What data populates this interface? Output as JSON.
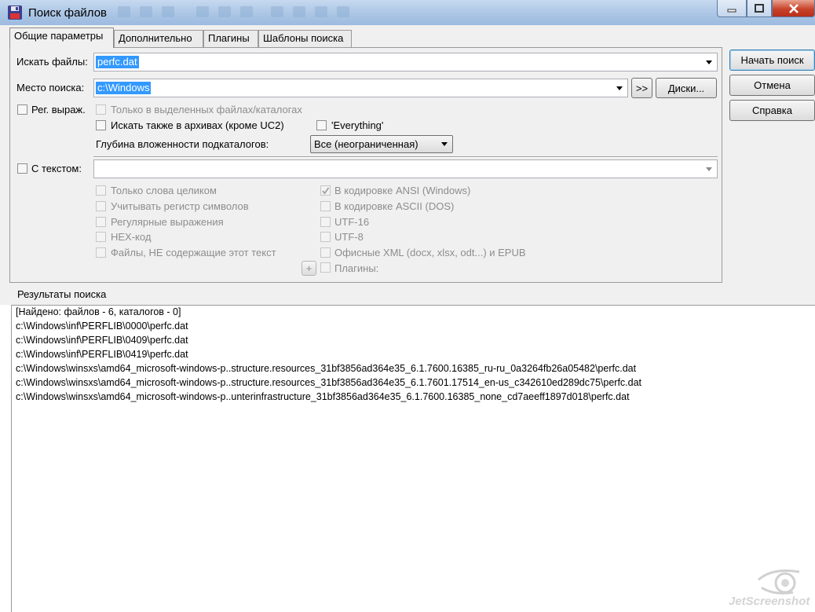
{
  "window": {
    "title": "Поиск файлов"
  },
  "tabs": [
    {
      "label": "Общие параметры"
    },
    {
      "label": "Дополнительно"
    },
    {
      "label": "Плагины"
    },
    {
      "label": "Шаблоны поиска"
    }
  ],
  "search": {
    "files_label": "Искать файлы:",
    "files_value": "perfc.dat",
    "location_label": "Место поиска:",
    "location_value": "c:\\Windows",
    "browse_label": ">>",
    "drives_label": "Диски...",
    "regex_label": "Рег. выраж.",
    "selected_only_label": "Только в выделенных файлах/каталогах",
    "archives_label": "Искать также в архивах (кроме UC2)",
    "everything_label": "'Everything'",
    "depth_label": "Глубина вложенности подкаталогов:",
    "depth_value": "Все (неограниченная)"
  },
  "text_search": {
    "with_text_label": "С текстом:",
    "whole_words_label": "Только слова целиком",
    "case_label": "Учитывать регистр символов",
    "regex_label": "Регулярные выражения",
    "hex_label": "HEX-код",
    "not_containing_label": "Файлы, НЕ содержащие этот текст",
    "plus_label": "+",
    "ansi_label": "В кодировке ANSI (Windows)",
    "ascii_label": "В кодировке ASCII (DOS)",
    "utf16_label": "UTF-16",
    "utf8_label": "UTF-8",
    "office_label": "Офисные XML (docx, xlsx, odt...) и EPUB",
    "plugins_label": "Плагины:"
  },
  "buttons": {
    "start_label": "Начать поиск",
    "cancel_label": "Отмена",
    "help_label": "Справка"
  },
  "results": {
    "header": "Результаты поиска",
    "lines": [
      " [Найдено: файлов - 6, каталогов - 0]",
      "c:\\Windows\\inf\\PERFLIB\\0000\\perfc.dat",
      "c:\\Windows\\inf\\PERFLIB\\0409\\perfc.dat",
      "c:\\Windows\\inf\\PERFLIB\\0419\\perfc.dat",
      "c:\\Windows\\winsxs\\amd64_microsoft-windows-p..structure.resources_31bf3856ad364e35_6.1.7600.16385_ru-ru_0a3264fb26a05482\\perfc.dat",
      "c:\\Windows\\winsxs\\amd64_microsoft-windows-p..structure.resources_31bf3856ad364e35_6.1.7601.17514_en-us_c342610ed289dc75\\perfc.dat",
      "c:\\Windows\\winsxs\\amd64_microsoft-windows-p..unterinfrastructure_31bf3856ad364e35_6.1.7600.16385_none_cd7aeeff1897d018\\perfc.dat"
    ]
  },
  "watermark": {
    "text": "JetScreenshot"
  }
}
